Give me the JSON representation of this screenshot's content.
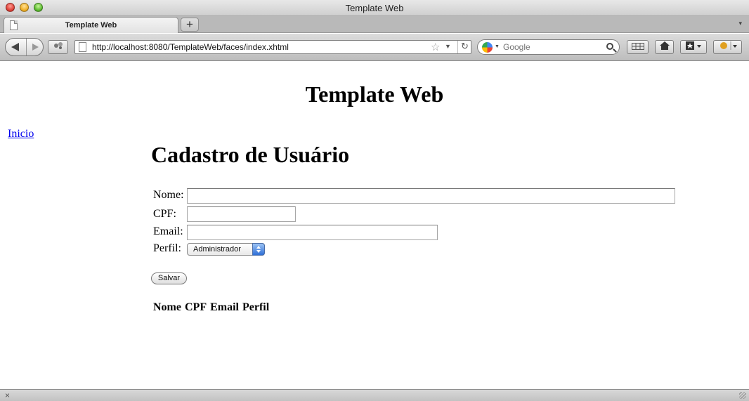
{
  "window": {
    "title": "Template Web"
  },
  "tabs": [
    {
      "label": "Template Web"
    }
  ],
  "tabbar": {
    "new_tab_label": "+",
    "menu_icon": "▾"
  },
  "navbar": {
    "url": "http://localhost:8080/TemplateWeb/faces/index.xhtml",
    "search_placeholder": "Google",
    "star_glyph": "☆",
    "dropdown_glyph": "▼",
    "reload_glyph": "↻"
  },
  "page": {
    "title": "Template Web",
    "menu_link": "Inicio",
    "heading": "Cadastro de Usuário",
    "form": {
      "nome_label": "Nome:",
      "cpf_label": "CPF:",
      "email_label": "Email:",
      "perfil_label": "Perfil:",
      "nome_value": "",
      "cpf_value": "",
      "email_value": "",
      "perfil_selected": "Administrador",
      "save_label": "Salvar"
    },
    "table": {
      "columns": [
        "Nome",
        "CPF",
        "Email",
        "Perfil"
      ]
    }
  },
  "statusbar": {
    "close_glyph": "×"
  }
}
